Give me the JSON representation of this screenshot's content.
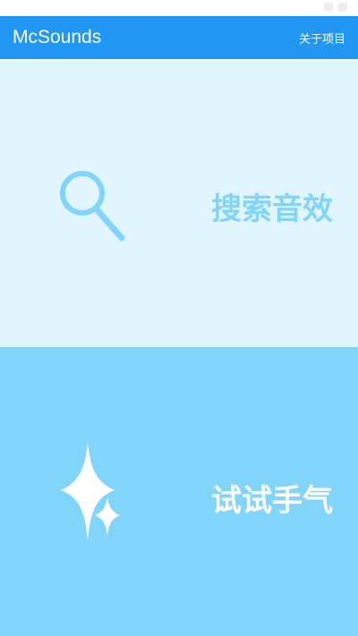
{
  "status_bar": {
    "time": ""
  },
  "app_bar": {
    "title": "McSounds",
    "about_label": "关于项目",
    "color": "#2196f3"
  },
  "panels": [
    {
      "label": "搜索音效",
      "icon": "search-icon",
      "background": "#e1f5fe",
      "text_color": "#81d4fa"
    },
    {
      "label": "试试手气",
      "icon": "sparkle-icon",
      "background": "#81d4fa",
      "text_color": "#ffffff"
    }
  ]
}
